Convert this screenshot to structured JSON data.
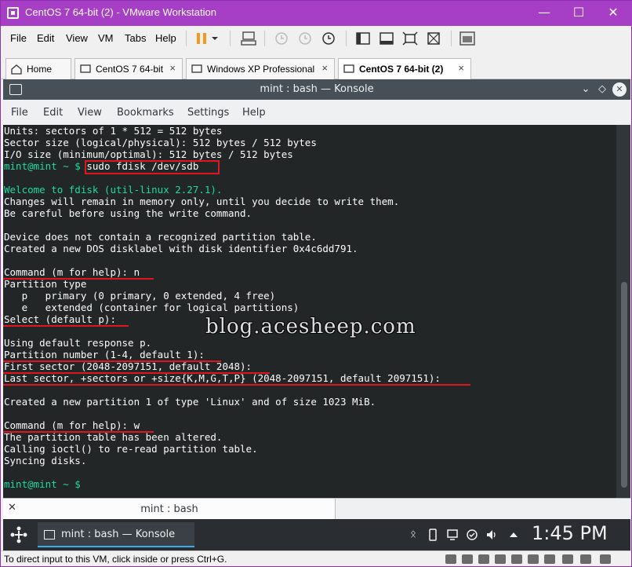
{
  "vmware": {
    "title": "CentOS 7 64-bit (2) - VMware Workstation",
    "menu": [
      "File",
      "Edit",
      "View",
      "VM",
      "Tabs",
      "Help"
    ],
    "tabs": [
      {
        "label": "Home"
      },
      {
        "label": "CentOS 7 64-bit"
      },
      {
        "label": "Windows XP Professional"
      },
      {
        "label": "CentOS 7 64-bit (2)",
        "active": true
      }
    ],
    "status": "To direct input to this VM, click inside or press Ctrl+G."
  },
  "konsole": {
    "title": "mint : bash — Konsole",
    "menu": [
      "File",
      "Edit",
      "View",
      "Bookmarks",
      "Settings",
      "Help"
    ],
    "tab_label": "mint : bash",
    "lines": [
      {
        "text": "Units: sectors of 1 * 512 = 512 bytes",
        "style": "normal"
      },
      {
        "text": "Sector size (logical/physical): 512 bytes / 512 bytes",
        "style": "normal"
      },
      {
        "text": "I/O size (minimum/optimal): 512 bytes / 512 bytes",
        "style": "normal"
      },
      {
        "text": "mint@mint ~ $ sudo fdisk /dev/sdb",
        "style": "prompt"
      },
      {
        "text": "",
        "style": "normal"
      },
      {
        "text": "Welcome to fdisk (util-linux 2.27.1).",
        "style": "green"
      },
      {
        "text": "Changes will remain in memory only, until you decide to write them.",
        "style": "normal"
      },
      {
        "text": "Be careful before using the write command.",
        "style": "normal"
      },
      {
        "text": "",
        "style": "normal"
      },
      {
        "text": "Device does not contain a recognized partition table.",
        "style": "normal"
      },
      {
        "text": "Created a new DOS disklabel with disk identifier 0x4c6dd791.",
        "style": "normal"
      },
      {
        "text": "",
        "style": "normal"
      },
      {
        "text": "Command (m for help): n",
        "style": "normal"
      },
      {
        "text": "Partition type",
        "style": "normal"
      },
      {
        "text": "   p   primary (0 primary, 0 extended, 4 free)",
        "style": "normal"
      },
      {
        "text": "   e   extended (container for logical partitions)",
        "style": "normal"
      },
      {
        "text": "Select (default p):",
        "style": "normal"
      },
      {
        "text": "",
        "style": "normal"
      },
      {
        "text": "Using default response p.",
        "style": "normal"
      },
      {
        "text": "Partition number (1-4, default 1):",
        "style": "normal"
      },
      {
        "text": "First sector (2048-2097151, default 2048):",
        "style": "normal"
      },
      {
        "text": "Last sector, +sectors or +size{K,M,G,T,P} (2048-2097151, default 2097151):",
        "style": "normal"
      },
      {
        "text": "",
        "style": "normal"
      },
      {
        "text": "Created a new partition 1 of type 'Linux' and of size 1023 MiB.",
        "style": "normal"
      },
      {
        "text": "",
        "style": "normal"
      },
      {
        "text": "Command (m for help): w",
        "style": "normal"
      },
      {
        "text": "The partition table has been altered.",
        "style": "normal"
      },
      {
        "text": "Calling ioctl() to re-read partition table.",
        "style": "normal"
      },
      {
        "text": "Syncing disks.",
        "style": "normal"
      },
      {
        "text": "",
        "style": "normal"
      },
      {
        "text": "mint@mint ~ $",
        "style": "prompt"
      }
    ],
    "watermark": "blog.acesheep.com"
  },
  "panel": {
    "task_label": "mint : bash — Konsole",
    "clock": "1:45 PM"
  },
  "colors": {
    "vmware_title": "#a63ec6",
    "terminal_bg": "#232627",
    "terminal_fg": "#fcfcfc",
    "prompt_green": "#1cdc9a",
    "highlight_red": "#e0161d"
  }
}
